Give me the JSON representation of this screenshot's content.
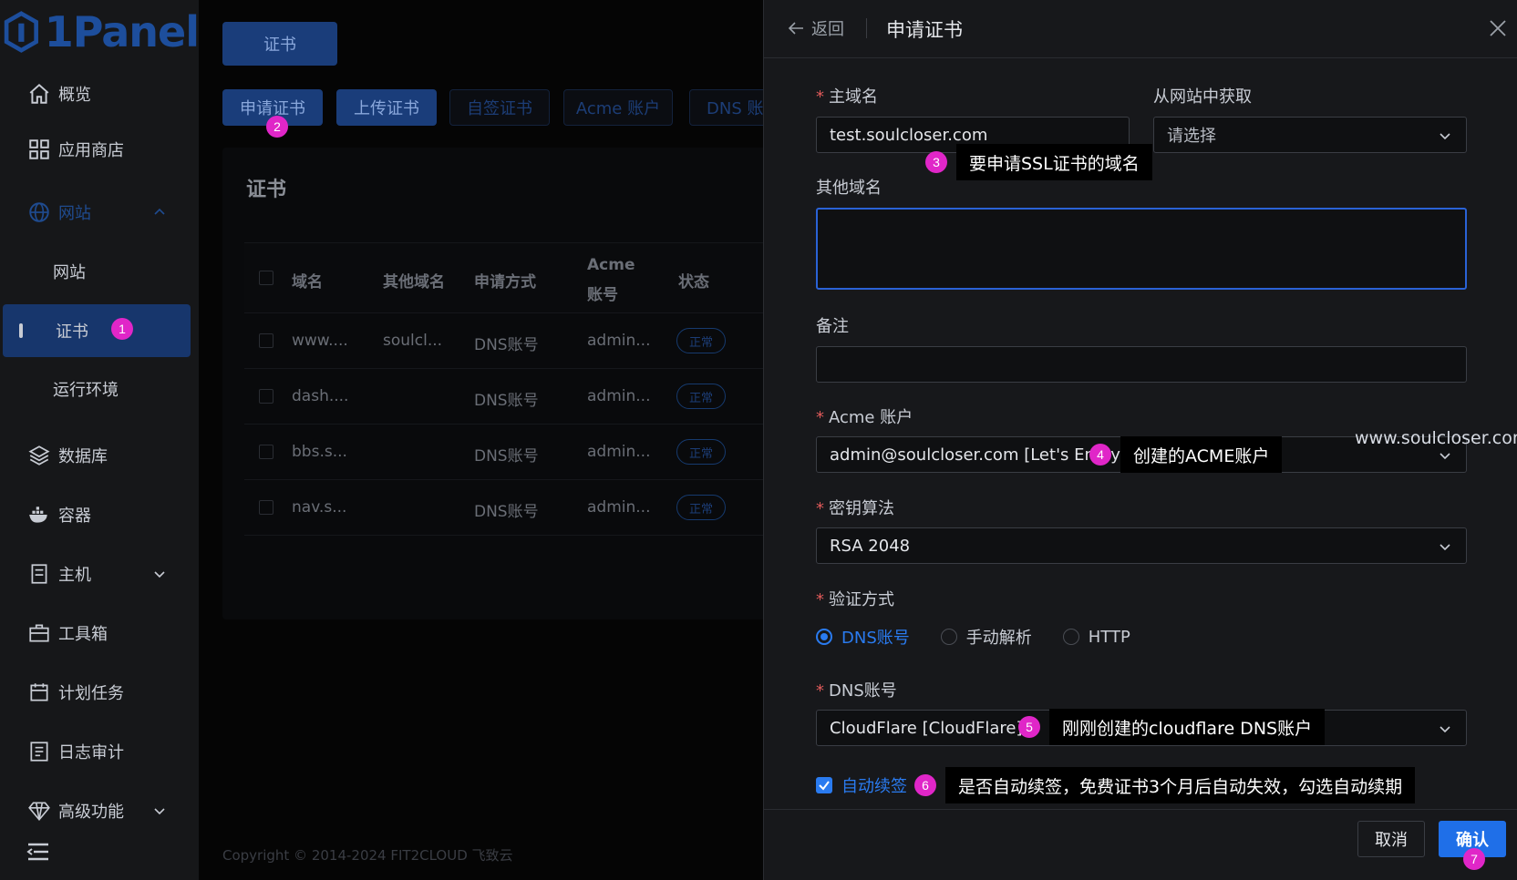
{
  "app": {
    "logo_text": "1Panel"
  },
  "sidebar": {
    "items": [
      {
        "label": "概览",
        "icon": "home-icon"
      },
      {
        "label": "应用商店",
        "icon": "grid-icon"
      },
      {
        "label": "网站",
        "icon": "globe-icon"
      },
      {
        "label": "网站",
        "icon": ""
      },
      {
        "label": "证书",
        "icon": "",
        "badge": "1"
      },
      {
        "label": "运行环境",
        "icon": ""
      },
      {
        "label": "数据库",
        "icon": "layers-icon"
      },
      {
        "label": "容器",
        "icon": "docker-icon"
      },
      {
        "label": "主机",
        "icon": "server-icon"
      },
      {
        "label": "工具箱",
        "icon": "toolbox-icon"
      },
      {
        "label": "计划任务",
        "icon": "calendar-icon"
      },
      {
        "label": "日志审计",
        "icon": "log-icon"
      },
      {
        "label": "高级功能",
        "icon": "diamond-icon"
      }
    ]
  },
  "main": {
    "top_button": "证书",
    "tabs": [
      {
        "label": "申请证书",
        "badge": "2"
      },
      {
        "label": "上传证书"
      },
      {
        "label": "自签证书"
      },
      {
        "label": "Acme 账户"
      },
      {
        "label": "DNS 账"
      }
    ],
    "card_title": "证书",
    "table": {
      "headers": [
        "域名",
        "其他域名",
        "申请方式",
        "Acme",
        "账号",
        "状态"
      ],
      "rows": [
        {
          "domain": "www....",
          "other": "soulcl...",
          "method": "DNS账号",
          "acme": "admin...",
          "status": "正常"
        },
        {
          "domain": "dash....",
          "other": "",
          "method": "DNS账号",
          "acme": "admin...",
          "status": "正常"
        },
        {
          "domain": "bbs.s...",
          "other": "",
          "method": "DNS账号",
          "acme": "admin...",
          "status": "正常"
        },
        {
          "domain": "nav.s...",
          "other": "",
          "method": "DNS账号",
          "acme": "admin...",
          "status": "正常"
        }
      ]
    },
    "copyright": "Copyright © 2014-2024 FIT2CLOUD 飞致云"
  },
  "drawer": {
    "back_label": "返回",
    "title": "申请证书",
    "primary_domain": {
      "label": "主域名",
      "value": "test.soulcloser.com"
    },
    "from_website": {
      "label": "从网站中获取",
      "placeholder": "请选择"
    },
    "other_domains": {
      "label": "其他域名",
      "value": ""
    },
    "remark": {
      "label": "备注",
      "value": ""
    },
    "acme_account": {
      "label": "Acme 账户",
      "value": "admin@soulcloser.com [Let's Encrypt]"
    },
    "key_algorithm": {
      "label": "密钥算法",
      "value": "RSA 2048"
    },
    "verify_method": {
      "label": "验证方式",
      "options": [
        "DNS账号",
        "手动解析",
        "HTTP"
      ],
      "selected": "DNS账号"
    },
    "dns_account": {
      "label": "DNS账号",
      "value": "CloudFlare [CloudFlare]"
    },
    "auto_renew": {
      "label": "自动续签",
      "checked": true
    },
    "cancel_label": "取消",
    "confirm_label": "确认",
    "confirm_badge": "7"
  },
  "annotations": [
    {
      "badge": "3",
      "text": "要申请SSL证书的域名"
    },
    {
      "badge": "4",
      "text": "创建的ACME账户"
    },
    {
      "badge": "5",
      "text": "刚刚创建的cloudflare DNS账户"
    },
    {
      "badge": "6",
      "text": "是否自动续签，免费证书3个月后自动失效，勾选自动续期"
    }
  ],
  "watermark": "www.soulcloser.com",
  "colors": {
    "accent": "#1f6fe8",
    "annotation_badge": "#e026c8",
    "required": "#e05a5a"
  }
}
